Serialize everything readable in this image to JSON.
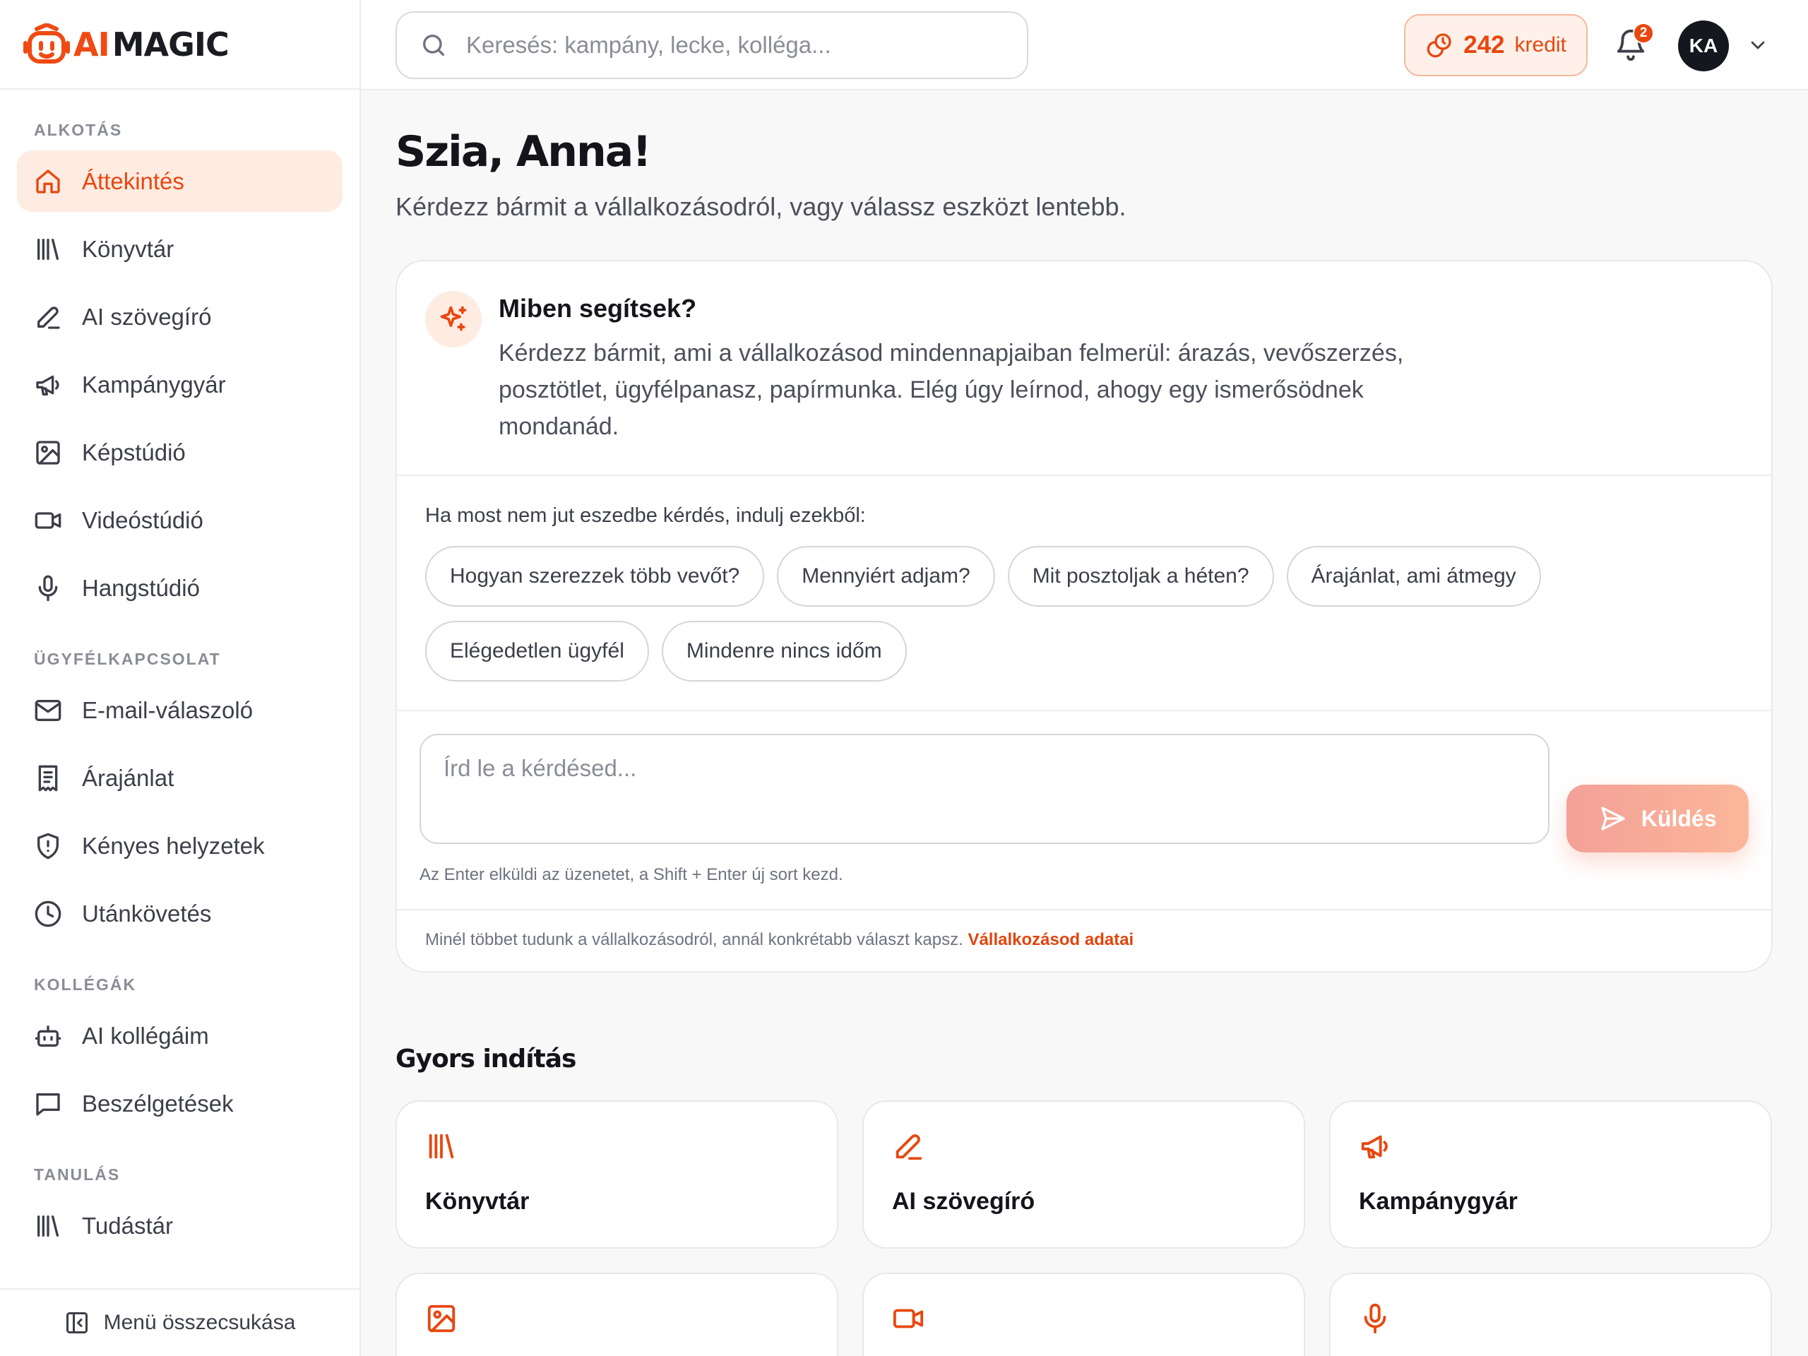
{
  "brand": {
    "logo_ai": "AI",
    "logo_magic": "MAGIC"
  },
  "sidebar": {
    "sections": [
      {
        "title": "ALKOTÁS",
        "items": [
          {
            "label": "Áttekintés",
            "icon": "home-icon",
            "active": true
          },
          {
            "label": "Könyvtár",
            "icon": "library-icon"
          },
          {
            "label": "AI szövegíró",
            "icon": "pen-icon"
          },
          {
            "label": "Kampánygyár",
            "icon": "megaphone-icon"
          },
          {
            "label": "Képstúdió",
            "icon": "image-icon"
          },
          {
            "label": "Videóstúdió",
            "icon": "video-icon"
          },
          {
            "label": "Hangstúdió",
            "icon": "microphone-icon"
          }
        ]
      },
      {
        "title": "ÜGYFÉLKAPCSOLAT",
        "items": [
          {
            "label": "E-mail-válaszoló",
            "icon": "mail-icon"
          },
          {
            "label": "Árajánlat",
            "icon": "receipt-icon"
          },
          {
            "label": "Kényes helyzetek",
            "icon": "shield-icon"
          },
          {
            "label": "Utánkövetés",
            "icon": "clock-icon"
          }
        ]
      },
      {
        "title": "KOLLÉGÁK",
        "items": [
          {
            "label": "AI kollégáim",
            "icon": "bot-icon"
          },
          {
            "label": "Beszélgetések",
            "icon": "chat-icon"
          }
        ]
      },
      {
        "title": "TANULÁS",
        "items": [
          {
            "label": "Tudástár",
            "icon": "library-icon"
          }
        ]
      }
    ],
    "collapse_label": "Menü összecsukása"
  },
  "header": {
    "search_placeholder": "Keresés: kampány, lecke, kolléga...",
    "credits_value": "242",
    "credits_label": "kredit",
    "notifications_count": "2",
    "avatar_initials": "KA"
  },
  "main": {
    "greeting": "Szia, Anna!",
    "subtitle": "Kérdezz bármit a vállalkozásodról, vagy válassz eszközt lentebb.",
    "assistant": {
      "title": "Miben segítsek?",
      "description": "Kérdezz bármit, ami a vállalkozásod mindennapjaiban felmerül: árazás, vevőszerzés, posztötlet, ügyfélpanasz, papírmunka. Elég úgy leírnod, ahogy egy ismerősödnek mondanád.",
      "prompts_label": "Ha most nem jut eszedbe kérdés, indulj ezekből:",
      "prompts": [
        "Hogyan szerezzek több vevőt?",
        "Mennyiért adjam?",
        "Mit posztoljak a héten?",
        "Árajánlat, ami átmegy",
        "Elégedetlen ügyfél",
        "Mindenre nincs időm"
      ],
      "input_placeholder": "Írd le a kérdésed...",
      "send_label": "Küldés",
      "hint": "Az Enter elküldi az üzenetet, a Shift + Enter új sort kezd.",
      "footer_text": "Minél többet tudunk a vállalkozásodról, annál konkrétabb választ kapsz.",
      "footer_link": "Vállalkozásod adatai"
    },
    "quick_title": "Gyors indítás",
    "quick_cards": [
      {
        "label": "Könyvtár",
        "icon": "library-icon"
      },
      {
        "label": "AI szövegíró",
        "icon": "pen-icon"
      },
      {
        "label": "Kampánygyár",
        "icon": "megaphone-icon"
      },
      {
        "label": "",
        "icon": "image-icon"
      },
      {
        "label": "",
        "icon": "video-icon"
      },
      {
        "label": "",
        "icon": "microphone-icon"
      }
    ]
  },
  "colors": {
    "accent": "#e8470f",
    "accent_soft": "#feebe2",
    "text": "#14141b",
    "muted": "#6f7280"
  }
}
